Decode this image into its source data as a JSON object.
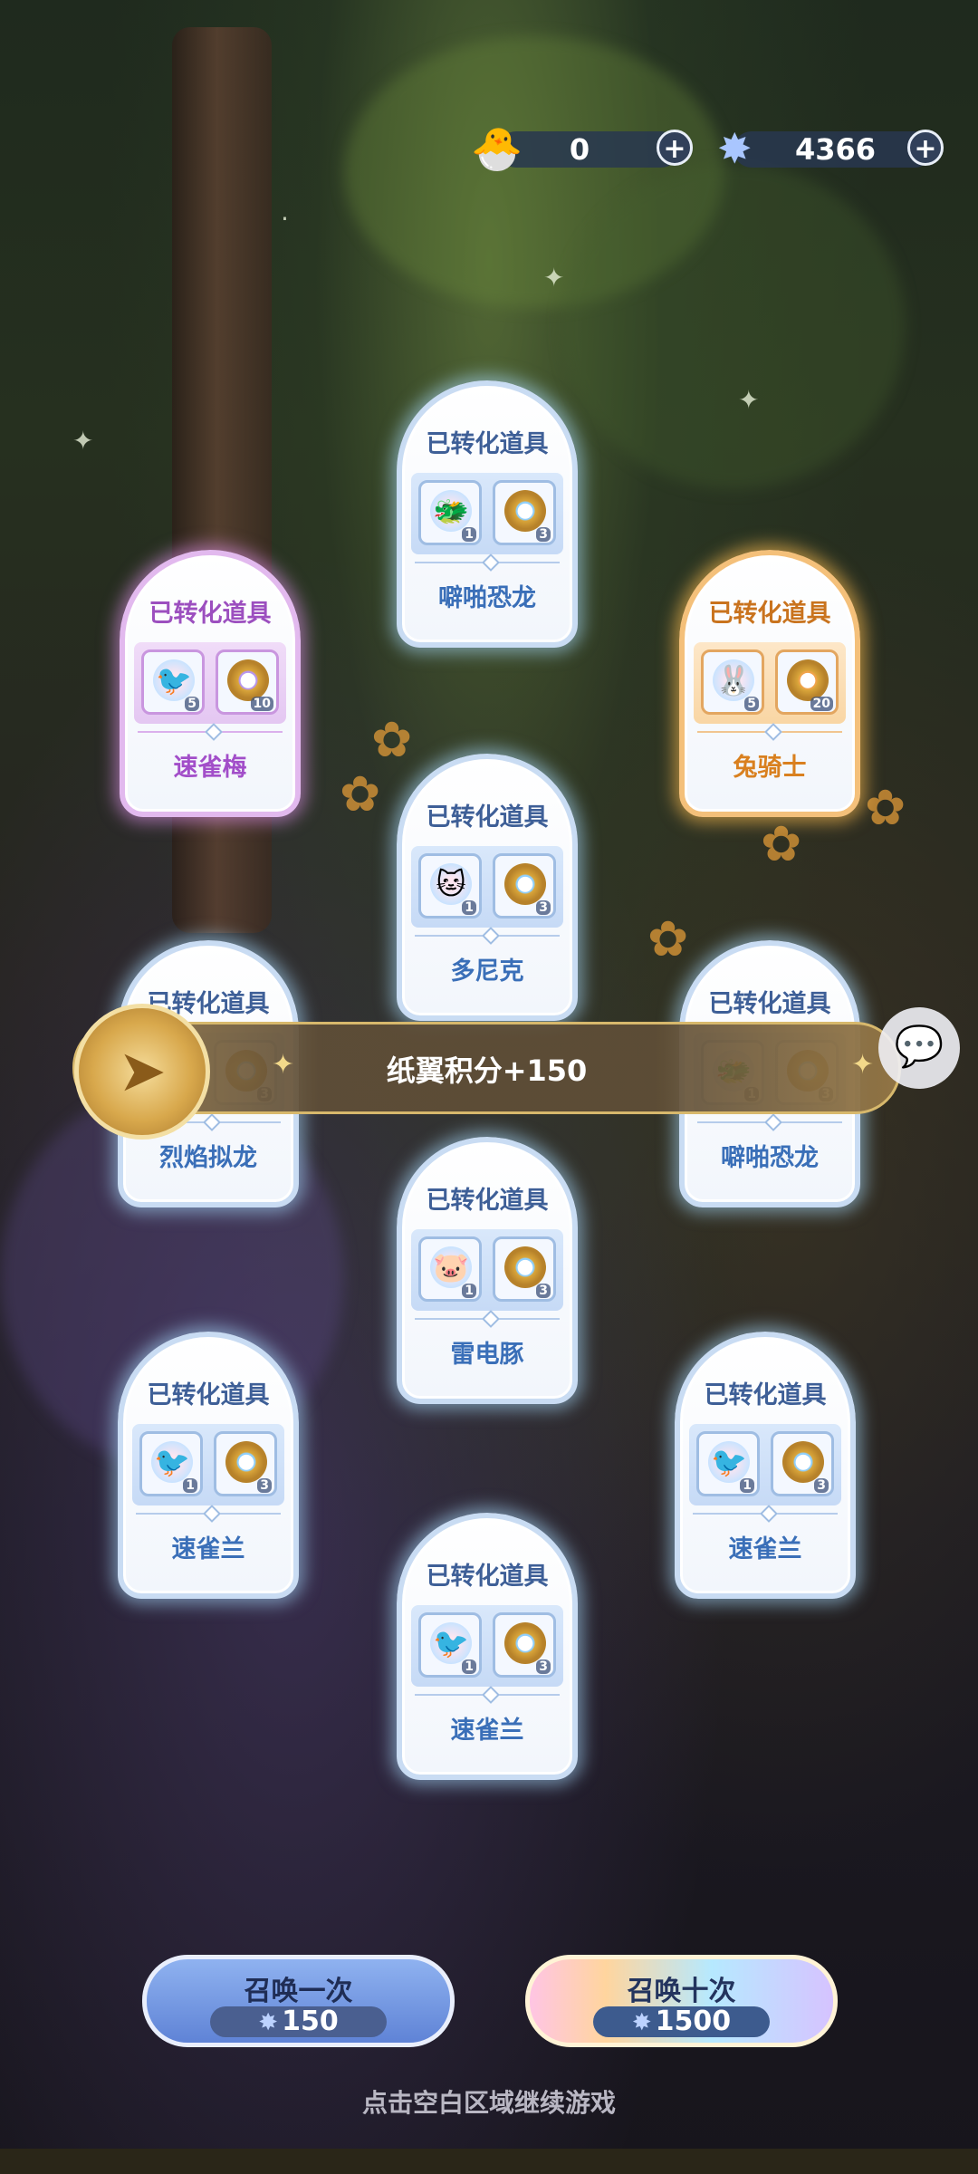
{
  "currencies": {
    "chicken": {
      "icon": "chicken-icon",
      "value": "0"
    },
    "gem": {
      "icon": "star-gem-icon",
      "value": "4366"
    }
  },
  "cards": [
    {
      "title": "已转化道具",
      "name": "噼啪恐龙",
      "variant": "blue",
      "items": [
        {
          "icon": "dino-pet-icon",
          "count": "1"
        },
        {
          "icon": "medal-icon",
          "count": "3"
        }
      ]
    },
    {
      "title": "已转化道具",
      "name": "速雀梅",
      "variant": "purple",
      "items": [
        {
          "icon": "bird-pet-icon",
          "count": "5"
        },
        {
          "icon": "medal-icon",
          "count": "10"
        }
      ]
    },
    {
      "title": "已转化道具",
      "name": "兔骑士",
      "variant": "orange",
      "items": [
        {
          "icon": "knight-pet-icon",
          "count": "5"
        },
        {
          "icon": "medal-icon",
          "count": "20"
        }
      ]
    },
    {
      "title": "已转化道具",
      "name": "多尼克",
      "variant": "blue",
      "items": [
        {
          "icon": "cat-pet-icon",
          "count": "1"
        },
        {
          "icon": "medal-icon",
          "count": "3"
        }
      ]
    },
    {
      "title": "已转化道具",
      "name": "烈焰拟龙",
      "variant": "blue",
      "items": [
        {
          "icon": "fire-pet-icon",
          "count": "1"
        },
        {
          "icon": "medal-icon",
          "count": "3"
        }
      ]
    },
    {
      "title": "已转化道具",
      "name": "噼啪恐龙",
      "variant": "blue",
      "items": [
        {
          "icon": "dino-pet-icon",
          "count": "1"
        },
        {
          "icon": "medal-icon",
          "count": "3"
        }
      ]
    },
    {
      "title": "已转化道具",
      "name": "雷电豚",
      "variant": "blue",
      "items": [
        {
          "icon": "pig-pet-icon",
          "count": "1"
        },
        {
          "icon": "medal-icon",
          "count": "3"
        }
      ]
    },
    {
      "title": "已转化道具",
      "name": "速雀兰",
      "variant": "blue",
      "items": [
        {
          "icon": "bird-pet-icon",
          "count": "1"
        },
        {
          "icon": "medal-icon",
          "count": "3"
        }
      ]
    },
    {
      "title": "已转化道具",
      "name": "速雀兰",
      "variant": "blue",
      "items": [
        {
          "icon": "bird-pet-icon",
          "count": "1"
        },
        {
          "icon": "medal-icon",
          "count": "3"
        }
      ]
    },
    {
      "title": "已转化道具",
      "name": "速雀兰",
      "variant": "blue",
      "items": [
        {
          "icon": "bird-pet-icon",
          "count": "1"
        },
        {
          "icon": "medal-icon",
          "count": "3"
        }
      ]
    }
  ],
  "banner": {
    "text": "纸翼积分+150",
    "badge_icon": "paper-plane-badge-icon"
  },
  "summon_one": {
    "label": "召唤一次",
    "cost": "150"
  },
  "summon_ten": {
    "label": "召唤十次",
    "cost": "1500"
  },
  "hint": "点击空白区域继续游戏"
}
